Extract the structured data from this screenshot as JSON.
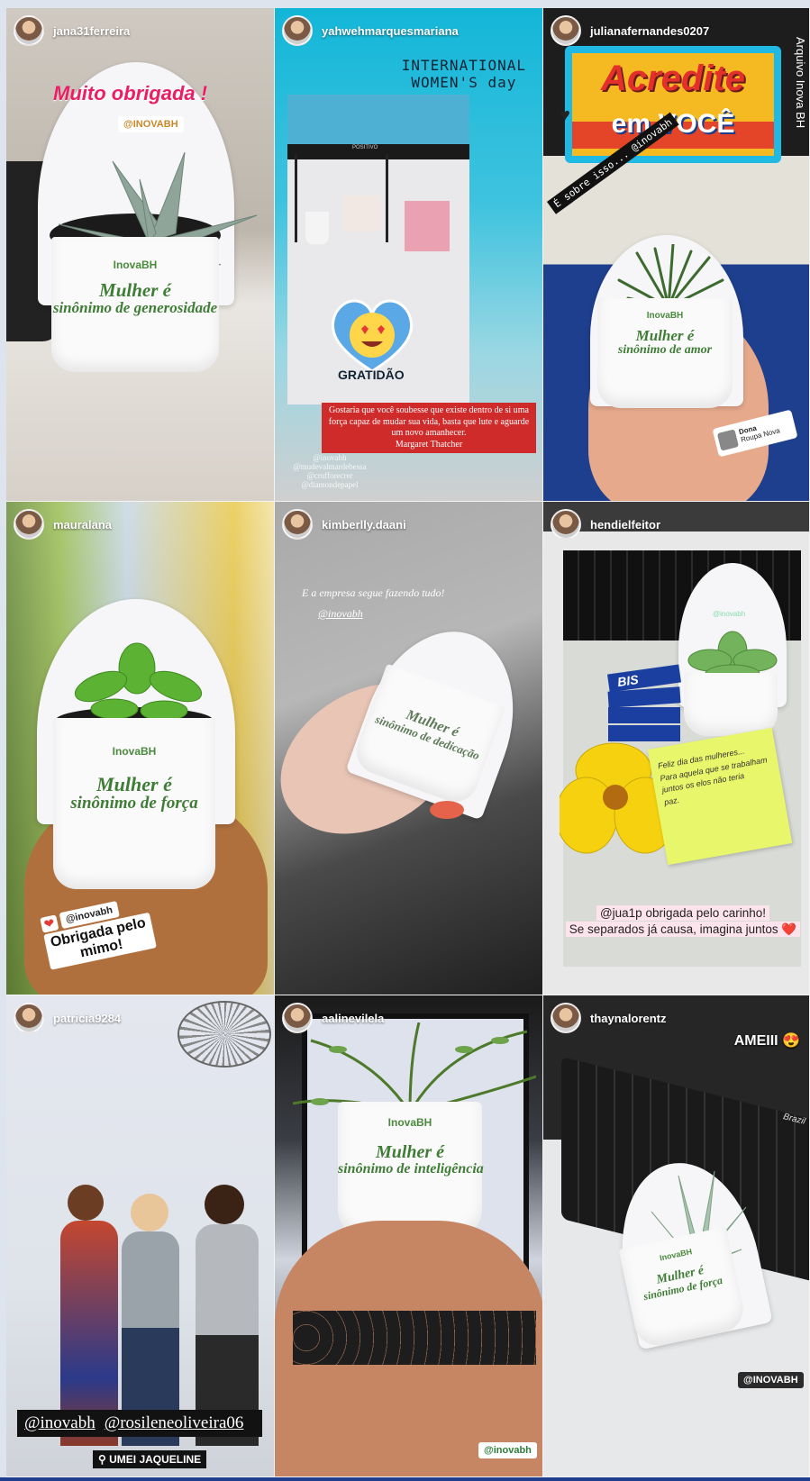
{
  "side_caption": "Arquivo Inova BH",
  "stories": [
    {
      "username": "jana31ferreira",
      "thanks_text": "Muito obrigada !",
      "mention": "@INOVABH",
      "brand": "InovaBH",
      "slogan_line1": "Mulher é",
      "slogan_line2": "sinônimo de generosidade"
    },
    {
      "username": "yahwehmarquesmariana",
      "title_line1": "INTERNATIONAL",
      "title_line2": "WOMEN'S day",
      "sticker": "GRATIDÃO",
      "monitor_brand": "POSITIVO",
      "quote": "Gostaria que você soubesse que existe dentro de si uma força capaz de mudar sua vida, basta que lute e aguarde um novo amanhecer.",
      "quote_author": "Margaret Thatcher",
      "mentions": [
        "@inovabh",
        "@mudevalmardebessa",
        "@crufforecrer",
        "@diamondepapel"
      ]
    },
    {
      "username": "julianafernandes0207",
      "banner_line1": "Acredite",
      "banner_line2": "em VOCÊ",
      "diagonal": "É sobre isso... @inovabh",
      "brand": "InovaBH",
      "slogan_line1": "Mulher é",
      "slogan_line2": "sinônimo de amor",
      "location_title": "Dona",
      "location_sub": "Roupa Nova"
    },
    {
      "username": "mauralana",
      "brand": "InovaBH",
      "slogan_line1": "Mulher é",
      "slogan_line2": "sinônimo de força",
      "mention": "@inovabh",
      "sticker_line1": "Obrigada pelo",
      "sticker_line2": "mimo!"
    },
    {
      "username": "kimberlly.daani",
      "caption": "E a empresa segue fazendo tudo!",
      "mention": "@inovabh",
      "slogan_line1": "Mulher é",
      "slogan_line2": "sinônimo de dedicação"
    },
    {
      "username": "hendielfeitor",
      "mention_small": "@inovabh",
      "candy": "BIS",
      "note_line1": "Feliz dia das mulheres...",
      "note_line2": "Para aquela que se trabalham",
      "note_line3": "juntos os elos não teria",
      "note_line4": "paz.",
      "caption_line1": "@jua1p obrigada pelo carinho!",
      "caption_line2": "Se separados já causa, imagina juntos ❤️"
    },
    {
      "username": "patricia9284",
      "mention1": "@inovabh",
      "mention2": "@rosileneoliveira06",
      "location": "UMEI JAQUELINE"
    },
    {
      "username": "aalinevilela",
      "brand": "InovaBH",
      "slogan_line1": "Mulher é",
      "slogan_line2": "sinônimo de inteligência",
      "mention": "@inovabh"
    },
    {
      "username": "thaynalorentz",
      "caption": "AMEIII 😍",
      "brand": "InovaBH",
      "slogan_line1": "Mulher é",
      "slogan_line2": "sinônimo de força",
      "mention": "@INOVABH",
      "keyboard_brand": "Brazil"
    }
  ]
}
